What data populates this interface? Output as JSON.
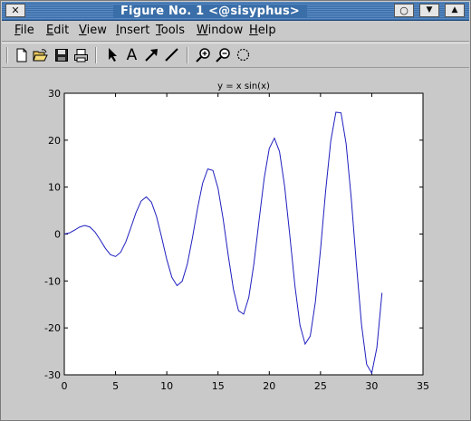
{
  "window": {
    "title": "Figure No. 1  <@sisyphus>",
    "controls": {
      "close": "✕",
      "circle": "○",
      "dropdown": "▼",
      "maximize": "▲"
    }
  },
  "menubar": {
    "items": [
      {
        "label": "File",
        "underline": "F",
        "rest": "ile"
      },
      {
        "label": "Edit",
        "underline": "E",
        "rest": "dit"
      },
      {
        "label": "View",
        "underline": "V",
        "rest": "iew"
      },
      {
        "label": "Insert",
        "underline": "I",
        "rest": "nsert"
      },
      {
        "label": "Tools",
        "underline": "T",
        "rest": "ools"
      },
      {
        "label": "Window",
        "underline": "W",
        "rest": "indow"
      },
      {
        "label": "Help",
        "underline": "H",
        "rest": "elp"
      }
    ]
  },
  "toolbar": {
    "icons": [
      "new-file-icon",
      "open-folder-icon",
      "save-icon",
      "print-icon",
      "select-arrow-icon",
      "insert-text-icon",
      "insert-arrow-icon",
      "insert-line-icon",
      "zoom-in-icon",
      "zoom-out-icon",
      "rotate-3d-icon"
    ],
    "text_tool_label": "A"
  },
  "colors": {
    "line": "#1f1fbf",
    "axes_bg": "#ffffff",
    "figure_bg": "#c9c9c9",
    "titlebar": "#3a6ea8"
  },
  "chart_data": {
    "type": "line",
    "title": "y = x sin(x)",
    "xlabel": "",
    "ylabel": "",
    "xlim": [
      0,
      35
    ],
    "ylim": [
      -30,
      30
    ],
    "xticks": [
      0,
      5,
      10,
      15,
      20,
      25,
      30,
      35
    ],
    "yticks": [
      -30,
      -20,
      -10,
      0,
      10,
      20,
      30
    ],
    "xtick_labels": [
      "0",
      "5",
      "10",
      "15",
      "20",
      "25",
      "30",
      "35"
    ],
    "ytick_labels": [
      "-30",
      "-20",
      "-10",
      "0",
      "10",
      "20",
      "30"
    ],
    "function": "x*sin(x)",
    "x_range": [
      0,
      31.4
    ],
    "sample_step": 0.5,
    "grid": false
  }
}
